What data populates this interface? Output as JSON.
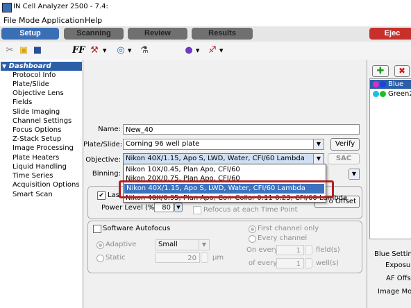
{
  "window": {
    "title": "IN Cell Analyzer 2500 - 7.4:"
  },
  "menu": [
    "File",
    "Mode",
    "Application",
    "Help"
  ],
  "tabs": {
    "setup": "Setup",
    "scanning": "Scanning",
    "review": "Review",
    "results": "Results",
    "eject": "Ejec"
  },
  "toolbar": {
    "fonts_label": "FF"
  },
  "sidebar": {
    "header": "Dashboard",
    "items": [
      "Protocol Info",
      "Plate/Slide",
      "Objective Lens",
      "Fields",
      "Slide Imaging",
      "Channel Settings",
      "Focus Options",
      "Z-Stack Setup",
      "Image Processing",
      "Plate Heaters",
      "Liquid Handling",
      "Time Series",
      "Acquisition Options",
      "Smart Scan"
    ]
  },
  "form": {
    "name_label": "Name:",
    "name_value": "New_40",
    "plate_label": "Plate/Slide:",
    "plate_value": "Corning 96 well plate",
    "verify_label": "Verify",
    "objective_label": "Objective:",
    "objective_value": "Nikon 40X/1.15, Apo S, LWD, Water, CFI/60 Lambda",
    "sac_label": "SAC",
    "binning_label": "Binning:",
    "objective_options": [
      "Nikon 10X/0.45, Plan Apo, CFI/60",
      "Nikon 20X/0.75, Plan Apo, CFI/60",
      "Nikon 40X/1.15, Apo S, LWD, Water, CFI/60 Lambda",
      "Nikon 40X/0.95, Plan Apo, Corr Collar 0.11-0.23, CFI/60 Lambda"
    ]
  },
  "laser": {
    "label": "Las",
    "power_label": "Power Level (%):",
    "power_value": "80",
    "refocus_label": "Refocus at each Time Point",
    "offset_label": "o Offset"
  },
  "software_af": {
    "label": "Software Autofocus",
    "adaptive_label": "Adaptive",
    "adaptive_value": "Small",
    "static_label": "Static",
    "static_value": "20",
    "static_unit": "µm",
    "first_channel_label": "First channel only",
    "every_channel_label": "Every channel",
    "on_every_label": "On every",
    "on_every_value": "1",
    "on_every_unit": "field(s)",
    "of_every_label": "of every",
    "of_every_value": "1",
    "of_every_unit": "well(s)"
  },
  "right_panel": {
    "channels": [
      {
        "name": "Blue",
        "color1": "#d030d0",
        "color2": "#2040e0"
      },
      {
        "name": "Green2",
        "color1": "#18c0e0",
        "color2": "#20c020"
      }
    ],
    "settings_title": "Blue Settings",
    "exposure_label": "Exposure",
    "af_offset_label": "AF Offset",
    "image_mode_label": "Image Mode"
  }
}
